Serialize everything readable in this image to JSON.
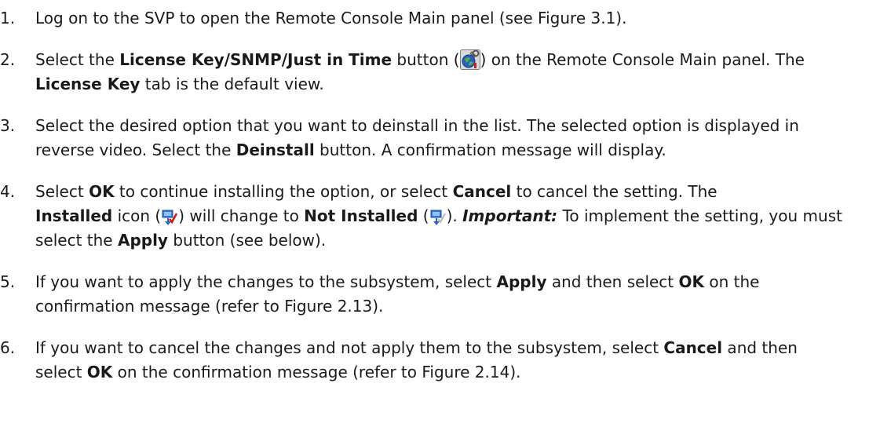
{
  "steps": [
    {
      "num": "1.",
      "t1": "Log on to the SVP to open the Remote Console Main panel (see Figure 3.1)."
    },
    {
      "num": "2.",
      "t1": "Select the ",
      "b1": "License Key/SNMP/Just in Time",
      "t2": " button (",
      "icon": "license-key-snmp-button-icon",
      "t3": ") on the Remote Console Main panel. The ",
      "b2": "License Key",
      "t4": " tab is the default view."
    },
    {
      "num": "3.",
      "t1": "Select the desired option that you want to deinstall in the list. The selected option is displayed in reverse video. Select the ",
      "b1": "Deinstall",
      "t2": " button. A confirmation message will display."
    },
    {
      "num": "4.",
      "t1": "Select ",
      "b1": "OK",
      "t2": " to continue installing the option, or select ",
      "b2": "Cancel",
      "t3": " to cancel the setting. The ",
      "b3": "Installed",
      "t4": " icon (",
      "icon1": "installed-icon",
      "t5": ") will change to ",
      "b4": "Not Installed",
      "t6": " (",
      "icon2": "not-installed-icon",
      "t7": "). ",
      "important": "Important:",
      "t8": " To implement the setting, you must select the ",
      "b5": "Apply",
      "t9": " button (see below)."
    },
    {
      "num": "5.",
      "t1": "If you want to apply the changes to the subsystem, select ",
      "b1": "Apply",
      "t2": " and then select ",
      "b2": "OK",
      "t3": " on the confirmation message (refer to Figure 2.13)."
    },
    {
      "num": "6.",
      "t1": "If you want to cancel the changes and not apply them to the subsystem, select ",
      "b1": "Cancel",
      "t2": " and then select ",
      "b2": "OK",
      "t3": " on the confirmation message (refer to Figure 2.14)."
    }
  ]
}
